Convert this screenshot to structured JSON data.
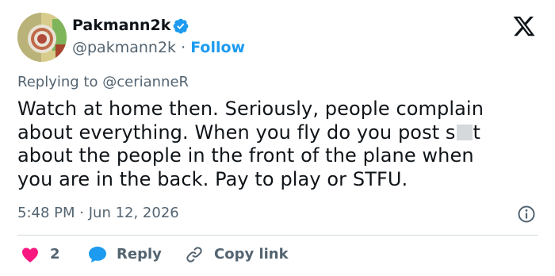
{
  "author": {
    "name": "Pakmann2k",
    "handle": "@pakmann2k",
    "separator": "·",
    "follow_label": "Follow"
  },
  "reply_context": {
    "prefix": "Replying to",
    "to": "@cerianneR"
  },
  "tweet": {
    "text_lines": [
      "Watch at home then. Seriously, people complain",
      "about everything. When you fly do you post s",
      "t",
      "about the people in the front of the plane when",
      "you are in the back. Pay to play or STFU."
    ]
  },
  "meta": {
    "time": "5:48 PM",
    "separator": "·",
    "date": "Jun 12, 2026"
  },
  "actions": {
    "like_count": "2",
    "reply_label": "Reply",
    "copy_link_label": "Copy link"
  },
  "colors": {
    "accent": "#1d9bf0",
    "text": "#0f1419",
    "muted": "#536471",
    "like": "#f91880",
    "divider": "#cfd9de"
  },
  "icons": [
    "verified-badge-icon",
    "x-logo-icon",
    "info-icon",
    "heart-icon",
    "reply-bubble-icon",
    "link-icon"
  ]
}
